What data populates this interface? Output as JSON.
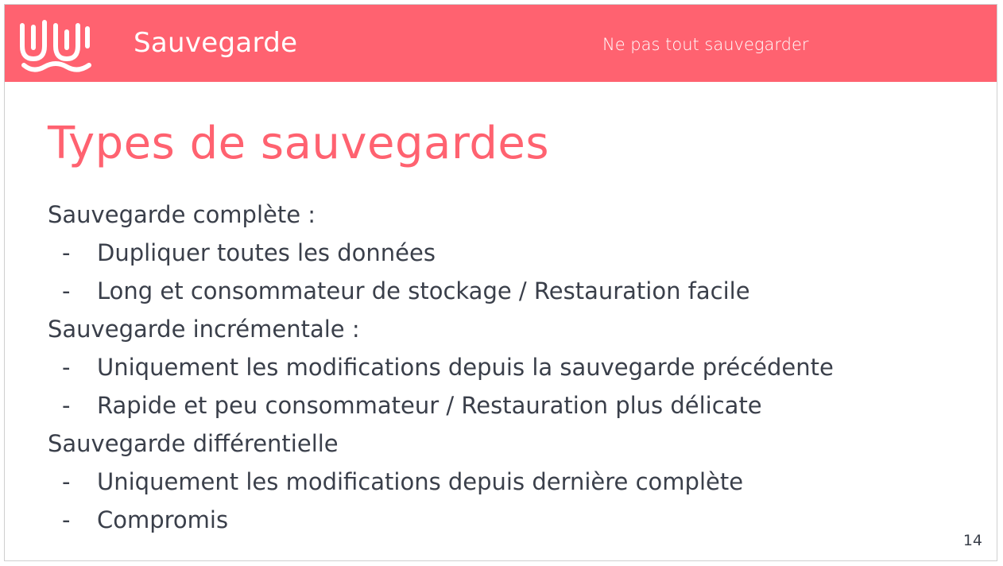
{
  "header": {
    "title": "Sauvegarde",
    "subtitle": "Ne pas tout sauvegarder",
    "logo_icon": "wave-logo-icon",
    "background_color": "#ff6270"
  },
  "slide": {
    "title": "Types de sauvegardes",
    "title_color": "#ff6270",
    "text_color": "#3a3f4a",
    "page_number": "14",
    "sections": [
      {
        "label": "Sauvegarde complète :",
        "bullets": [
          "Dupliquer toutes les données",
          "Long et consommateur de stockage / Restauration facile"
        ]
      },
      {
        "label": "Sauvegarde incrémentale :",
        "bullets": [
          "Uniquement les modifications depuis la sauvegarde précédente",
          "Rapide et peu consommateur / Restauration plus délicate"
        ]
      },
      {
        "label": "Sauvegarde différentielle",
        "bullets": [
          "Uniquement les modifications depuis dernière complète",
          "Compromis"
        ]
      }
    ],
    "bullet_marker": "-"
  }
}
